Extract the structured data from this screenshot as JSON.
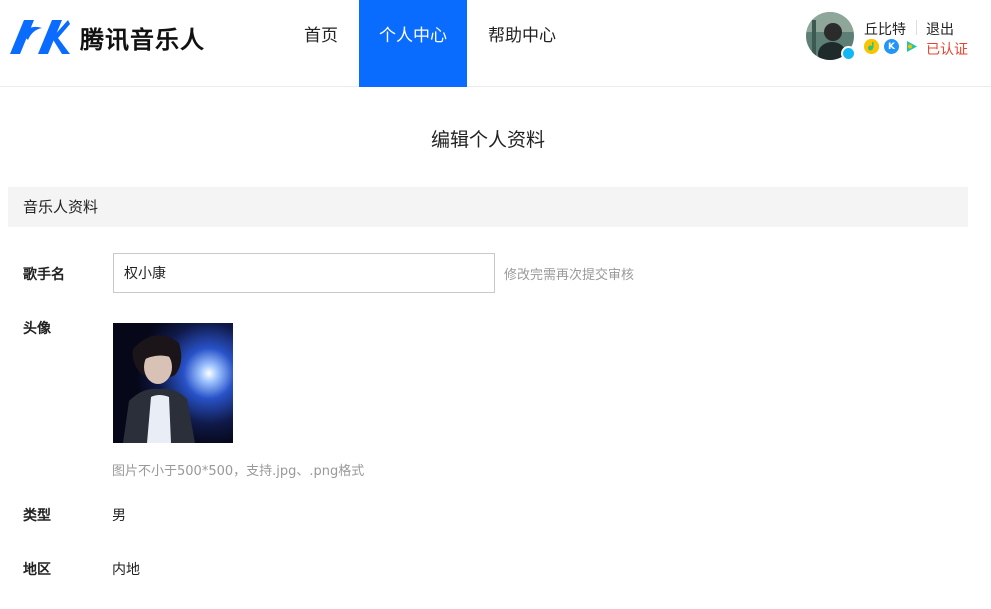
{
  "brand": {
    "name": "腾讯音乐人"
  },
  "nav": {
    "items": [
      {
        "label": "首页"
      },
      {
        "label": "个人中心"
      },
      {
        "label": "帮助中心"
      }
    ],
    "active_index": 1
  },
  "user": {
    "name": "丘比特",
    "logout_label": "退出",
    "status": "已认证",
    "platform_icons": [
      "qq-music-icon",
      "kugou-icon",
      "kuwo-icon"
    ]
  },
  "page": {
    "title": "编辑个人资料",
    "section_title": "音乐人资料"
  },
  "form": {
    "singer_name": {
      "label": "歌手名",
      "value": "权小康",
      "hint": "修改完需再次提交审核"
    },
    "avatar": {
      "label": "头像",
      "hint": "图片不小于500*500，支持.jpg、.png格式"
    },
    "type": {
      "label": "类型",
      "value": "男"
    },
    "region": {
      "label": "地区",
      "value": "内地"
    }
  },
  "colors": {
    "accent": "#0a6cff",
    "verified": "#e8432f",
    "hint": "#999999",
    "section_bg": "#f4f4f4"
  }
}
